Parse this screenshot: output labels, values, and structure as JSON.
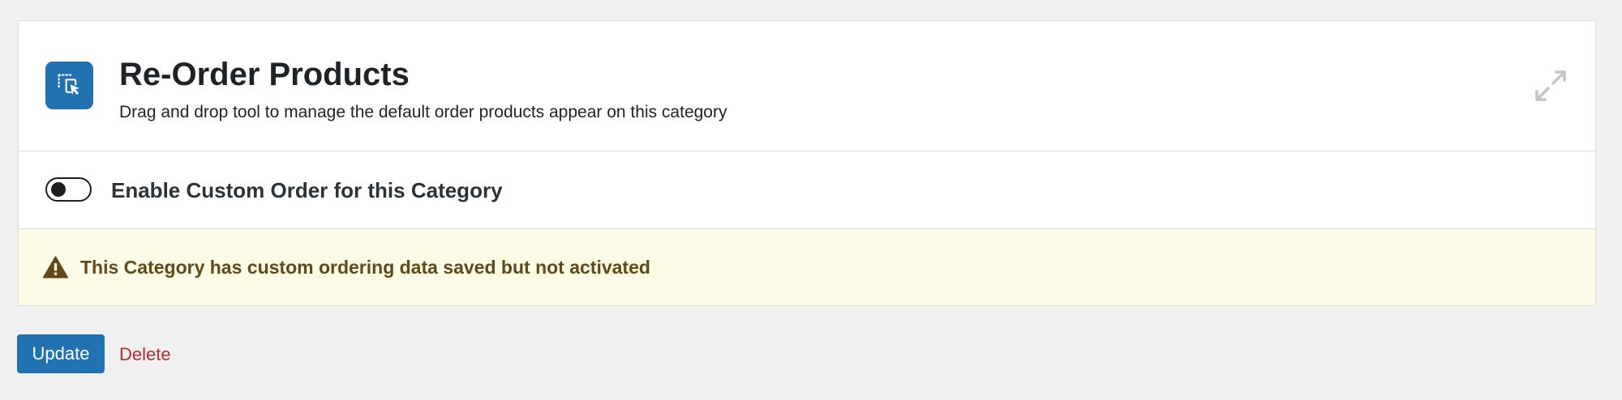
{
  "colors": {
    "page_background": "#f0f0f1",
    "panel_background": "#ffffff",
    "accent": "#2271b1",
    "notice_background": "#fcfbe6",
    "notice_text": "#614a19",
    "delete_link": "#b32d2e",
    "expand_icon": "#c3c4c7"
  },
  "header": {
    "icon": "reorder-select-icon",
    "title": "Re-Order Products",
    "subtitle": "Drag and drop tool to manage the default order products appear on this category",
    "expand_icon": "expand-arrows-icon"
  },
  "toggle": {
    "label": "Enable Custom Order for this Category",
    "enabled": false
  },
  "notice": {
    "icon": "warning-icon",
    "text": "This Category has custom ordering data saved but not activated"
  },
  "actions": {
    "update_label": "Update",
    "delete_label": "Delete"
  }
}
